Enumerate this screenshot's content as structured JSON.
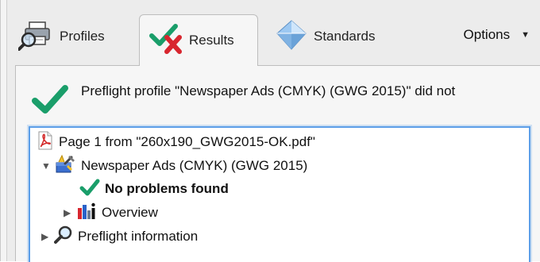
{
  "tabs": {
    "profiles": {
      "label": "Profiles",
      "icon": "printer-magnifier-icon"
    },
    "results": {
      "label": "Results",
      "icon": "check-cross-icon"
    },
    "standards": {
      "label": "Standards",
      "icon": "diamond-icon"
    },
    "options": {
      "label": "Options"
    }
  },
  "status": {
    "message": "Preflight profile \"Newspaper Ads (CMYK) (GWG 2015)\" did not",
    "icon": "green-check-icon"
  },
  "tree": {
    "page": {
      "label": "Page 1 from \"260x190_GWG2015-OK.pdf\"",
      "icon": "pdf-icon"
    },
    "profile": {
      "label": "Newspaper Ads (CMYK) (GWG 2015)",
      "icon": "profile-toolbox-icon"
    },
    "result": {
      "label": "No problems found",
      "icon": "green-check-icon"
    },
    "overview": {
      "label": "Overview",
      "icon": "overview-chart-icon"
    },
    "info": {
      "label": "Preflight information",
      "icon": "magnifier-icon"
    }
  },
  "colors": {
    "accent_green": "#1a9e6a",
    "cross_red": "#d8262f",
    "focus_blue": "#5b9ee8",
    "pdf_red": "#d42a2a"
  }
}
